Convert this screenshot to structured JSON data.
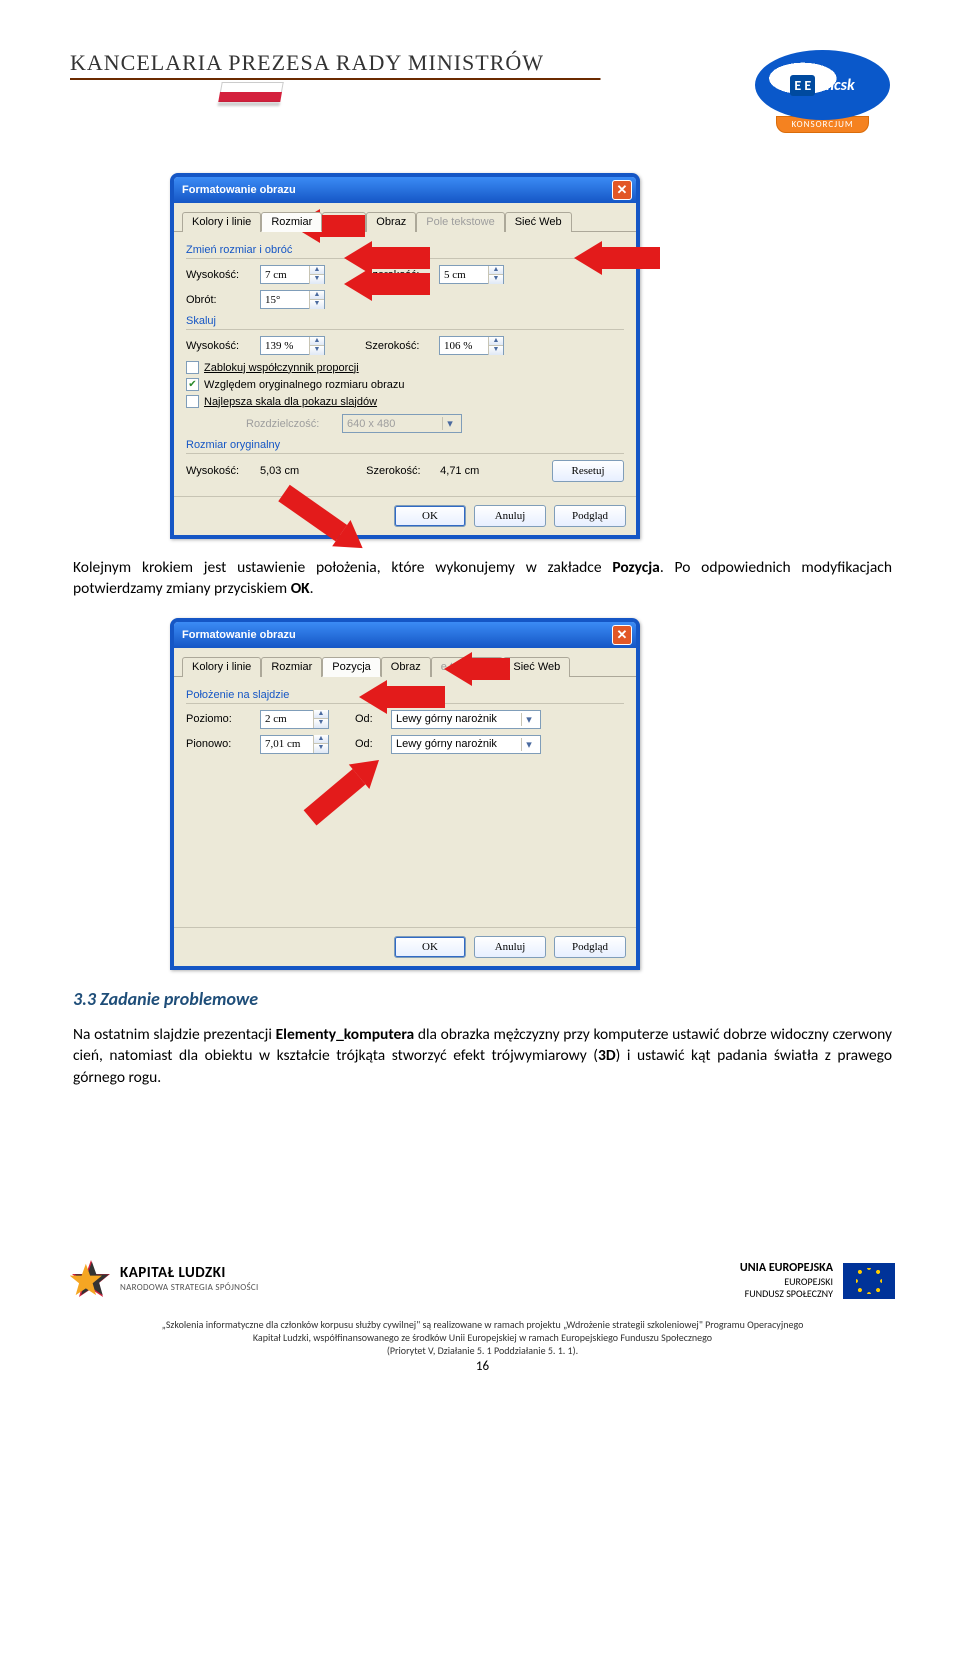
{
  "header": {
    "kprm": "KANCELARIA PREZESA RADY MINISTRÓW",
    "konsorcjum": "KONSORCJUM",
    "ee": "E E",
    "mcsk": "mcsk"
  },
  "dlg1": {
    "title": "Formatowanie obrazu",
    "tabs": {
      "kolory": "Kolory i linie",
      "rozmiar": "Rozmiar",
      "pozycja": "Pozycja",
      "obraz": "Obraz",
      "pole": "Pole tekstowe",
      "web": "Sieć Web"
    },
    "grp_resize": "Zmień rozmiar i obróć",
    "wysokosc_lbl": "Wysokość:",
    "wysokosc_val": "7 cm",
    "szerokosc_lbl": "Szerokość:",
    "szerokosc_val": "5 cm",
    "obrot_lbl": "Obrót:",
    "obrot_val": "15°",
    "grp_skaluj": "Skaluj",
    "sk_wys_val": "139 %",
    "sk_szer_val": "106 %",
    "chk_lock": "Zablokuj współczynnik proporcji",
    "chk_orig": "Względem oryginalnego rozmiaru obrazu",
    "chk_slide": "Najlepsza skala dla pokazu slajdów",
    "rozdz_lbl": "Rozdzielczość:",
    "rozdz_val": "640 x 480",
    "grp_oryg": "Rozmiar oryginalny",
    "oryg_wys": "5,03 cm",
    "oryg_szer": "4,71 cm",
    "btn_reset": "Resetuj",
    "btn_ok": "OK",
    "btn_anuluj": "Anuluj",
    "btn_podglad": "Podgląd"
  },
  "para1_a": "Kolejnym krokiem jest ustawienie położenia, które wykonujemy w zakładce ",
  "para1_b": "Pozycja",
  "para1_c": ". Po odpowiednich modyfikacjach potwierdzamy zmiany przyciskiem ",
  "para1_d": "OK",
  "para1_e": ".",
  "dlg2": {
    "title": "Formatowanie obrazu",
    "tabs": {
      "kolory": "Kolory i linie",
      "rozmiar": "Rozmiar",
      "pozycja": "Pozycja",
      "obraz": "Obraz",
      "pole": "e tekstowe",
      "web": "Sieć Web"
    },
    "grp": "Położenie na slajdzie",
    "poziomo_lbl": "Poziomo:",
    "poziomo_val": "2 cm",
    "pionowo_lbl": "Pionowo:",
    "pionowo_val": "7,01 cm",
    "od_lbl": "Od:",
    "od_val": "Lewy górny narożnik",
    "btn_ok": "OK",
    "btn_anuluj": "Anuluj",
    "btn_podglad": "Podgląd"
  },
  "heading": "3.3 Zadanie problemowe",
  "para2_a": "Na ostatnim slajdzie prezentacji ",
  "para2_b": "Elementy_komputera",
  "para2_c": " dla obrazka mężczyzny przy komputerze ustawić dobrze widoczny czerwony cień, natomiast dla obiektu w kształcie trójkąta stworzyć efekt trójwymiarowy (",
  "para2_d": "3D",
  "para2_e": ") i ustawić kąt padania światła z prawego górnego rogu.",
  "footer": {
    "kl1": "KAPITAŁ LUDZKI",
    "kl2": "NARODOWA STRATEGIA SPÓJNOŚCI",
    "ue1": "UNIA EUROPEJSKA",
    "ue2": "EUROPEJSKI",
    "ue3": "FUNDUSZ SPOŁECZNY",
    "line1": "„Szkolenia informatyczne dla członków korpusu służby cywilnej\" są realizowane w ramach projektu „Wdrożenie strategii szkoleniowej\" Programu Operacyjnego",
    "line2": "Kapitał Ludzki, współfinansowanego ze środków Unii Europejskiej w ramach Europejskiego Funduszu Społecznego",
    "line3": "(Priorytet V, Działanie 5. 1 Poddziałanie 5. 1. 1).",
    "pagenum": "16"
  }
}
